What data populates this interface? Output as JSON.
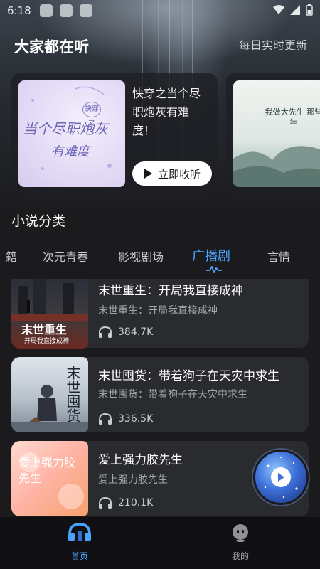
{
  "status": {
    "time": "6:18"
  },
  "header": {
    "title": "大家都在听",
    "subtitle": "每日实时更新"
  },
  "featured": [
    {
      "title": "快穿之当个尽职炮灰有难度！",
      "cover_text_line1": "当个尽职炮灰",
      "cover_text_line2": "有难度",
      "cover_badge": "快穿之",
      "button_label": "立即收听"
    },
    {
      "cover_text": "我做大先生 那些年"
    }
  ],
  "section": {
    "title": "小说分类"
  },
  "tabs": [
    {
      "label": "籍"
    },
    {
      "label": "次元青春"
    },
    {
      "label": "影视剧场"
    },
    {
      "label": "广播剧",
      "active": true
    },
    {
      "label": "言情"
    }
  ],
  "list": [
    {
      "title": "末世重生：开局我直接成神",
      "subtitle": "末世重生：开局我直接成神",
      "plays": "384.7K",
      "cover_text": "末世重生",
      "cover_subtext": "开局我直接成神"
    },
    {
      "title": "末世囤货：带着狗子在天灾中求生",
      "subtitle": "末世囤货：带着狗子在天灾中求生",
      "plays": "336.5K",
      "cover_text": "末世囤货"
    },
    {
      "title": "爱上强力胶先生",
      "subtitle": "爱上强力胶先生",
      "plays": "210.1K",
      "cover_text": "爱上强力胶先生"
    }
  ],
  "bottom_nav": [
    {
      "label": "首页",
      "icon": "headphones-icon",
      "active": true
    },
    {
      "label": "我的",
      "icon": "profile-icon",
      "active": false
    }
  ],
  "colors": {
    "accent": "#4aa3ff",
    "background": "#1b1b1d",
    "card": "#2a2b2f"
  }
}
